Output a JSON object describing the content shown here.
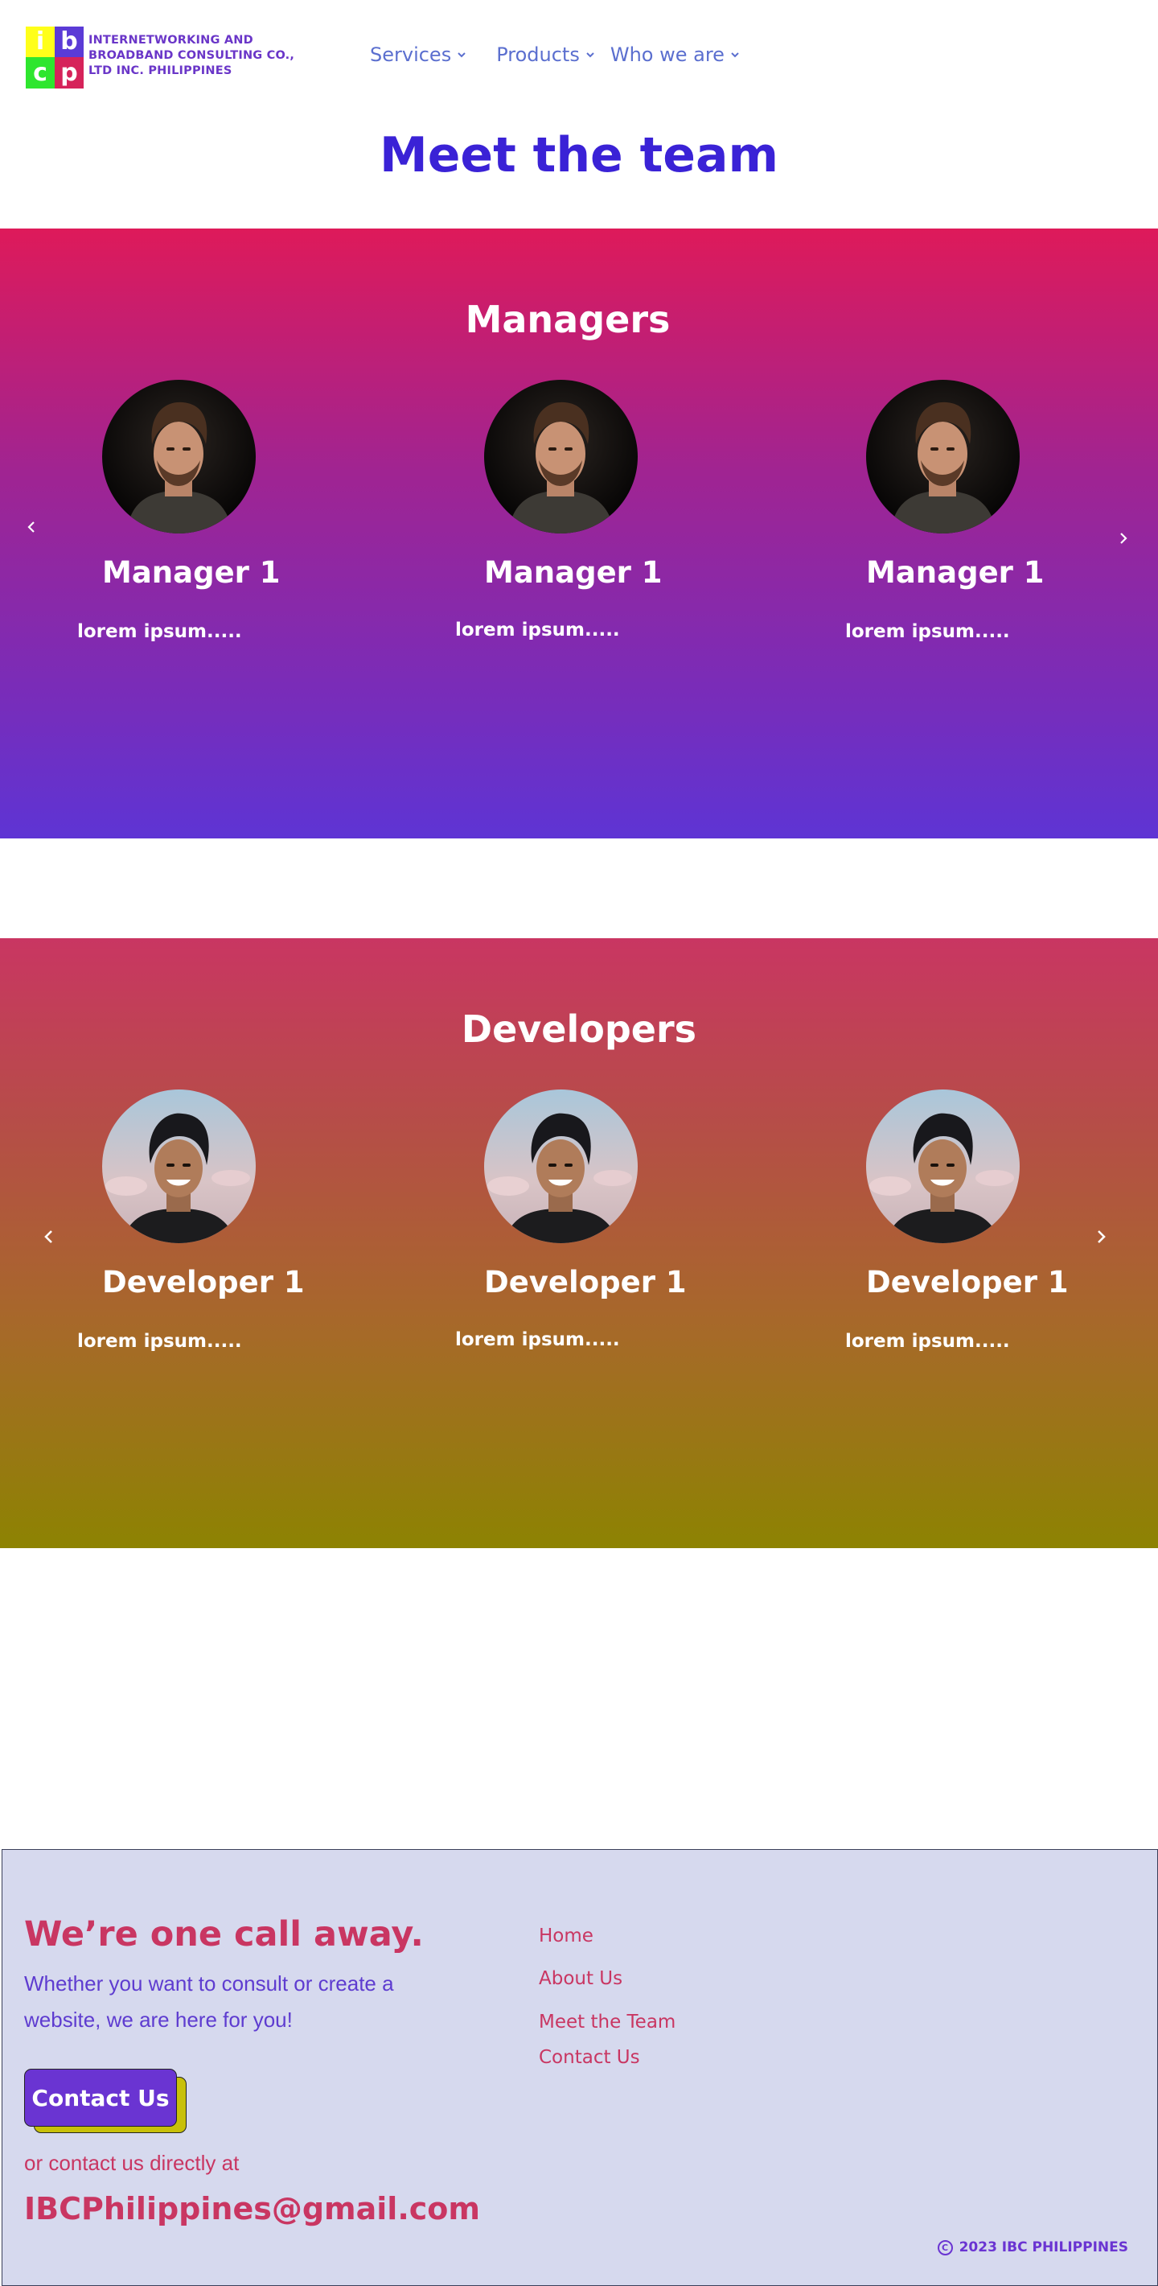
{
  "header": {
    "logo": {
      "letters": [
        "i",
        "b",
        "c",
        "p"
      ],
      "colors": [
        "#ffff1a",
        "#5b3bd6",
        "#2ee62e",
        "#d6235a"
      ],
      "text_line1": "INTERNETWORKING AND",
      "text_line2": "BROADBAND CONSULTING CO.,",
      "text_line3": "LTD INC. PHILIPPINES"
    },
    "nav": [
      {
        "label": "Services",
        "icon": "chevron-down-icon"
      },
      {
        "label": "Products",
        "icon": "chevron-down-icon"
      },
      {
        "label": "Who we are",
        "icon": "chevron-down-icon"
      }
    ]
  },
  "page_title": "Meet the team",
  "managers": {
    "title": "Managers",
    "members": [
      {
        "name": "Manager 1",
        "desc": "lorem ipsum....."
      },
      {
        "name": "Manager 1",
        "desc": "lorem ipsum....."
      },
      {
        "name": "Manager 1",
        "desc": "lorem ipsum....."
      }
    ],
    "prev_icon": "chevron-left-icon",
    "next_icon": "chevron-right-icon"
  },
  "developers": {
    "title": "Developers",
    "members": [
      {
        "name": "Developer 1",
        "desc": "lorem ipsum....."
      },
      {
        "name": "Developer 1",
        "desc": "lorem ipsum....."
      },
      {
        "name": "Developer 1",
        "desc": "lorem ipsum....."
      }
    ],
    "prev_icon": "chevron-left-icon",
    "next_icon": "chevron-right-icon"
  },
  "footer": {
    "title": "We’re one call away.",
    "subtitle": "Whether you want to consult or create a website, we are here for you!",
    "contact_button": "Contact Us",
    "or_text": "or contact us directly at",
    "email": "IBCPhilippines@gmail.com",
    "links": [
      "Home",
      "About Us",
      "Meet the Team",
      "Contact Us"
    ],
    "copyright_icon": "copyright-icon",
    "copyright": "2023 IBC PHILIPPINES"
  },
  "colors": {
    "accent_blue": "#3a22d6",
    "accent_pink": "#c93662",
    "accent_purple": "#6a34d2",
    "footer_bg": "#d6d9ee",
    "button_shadow": "#c8c00a"
  }
}
